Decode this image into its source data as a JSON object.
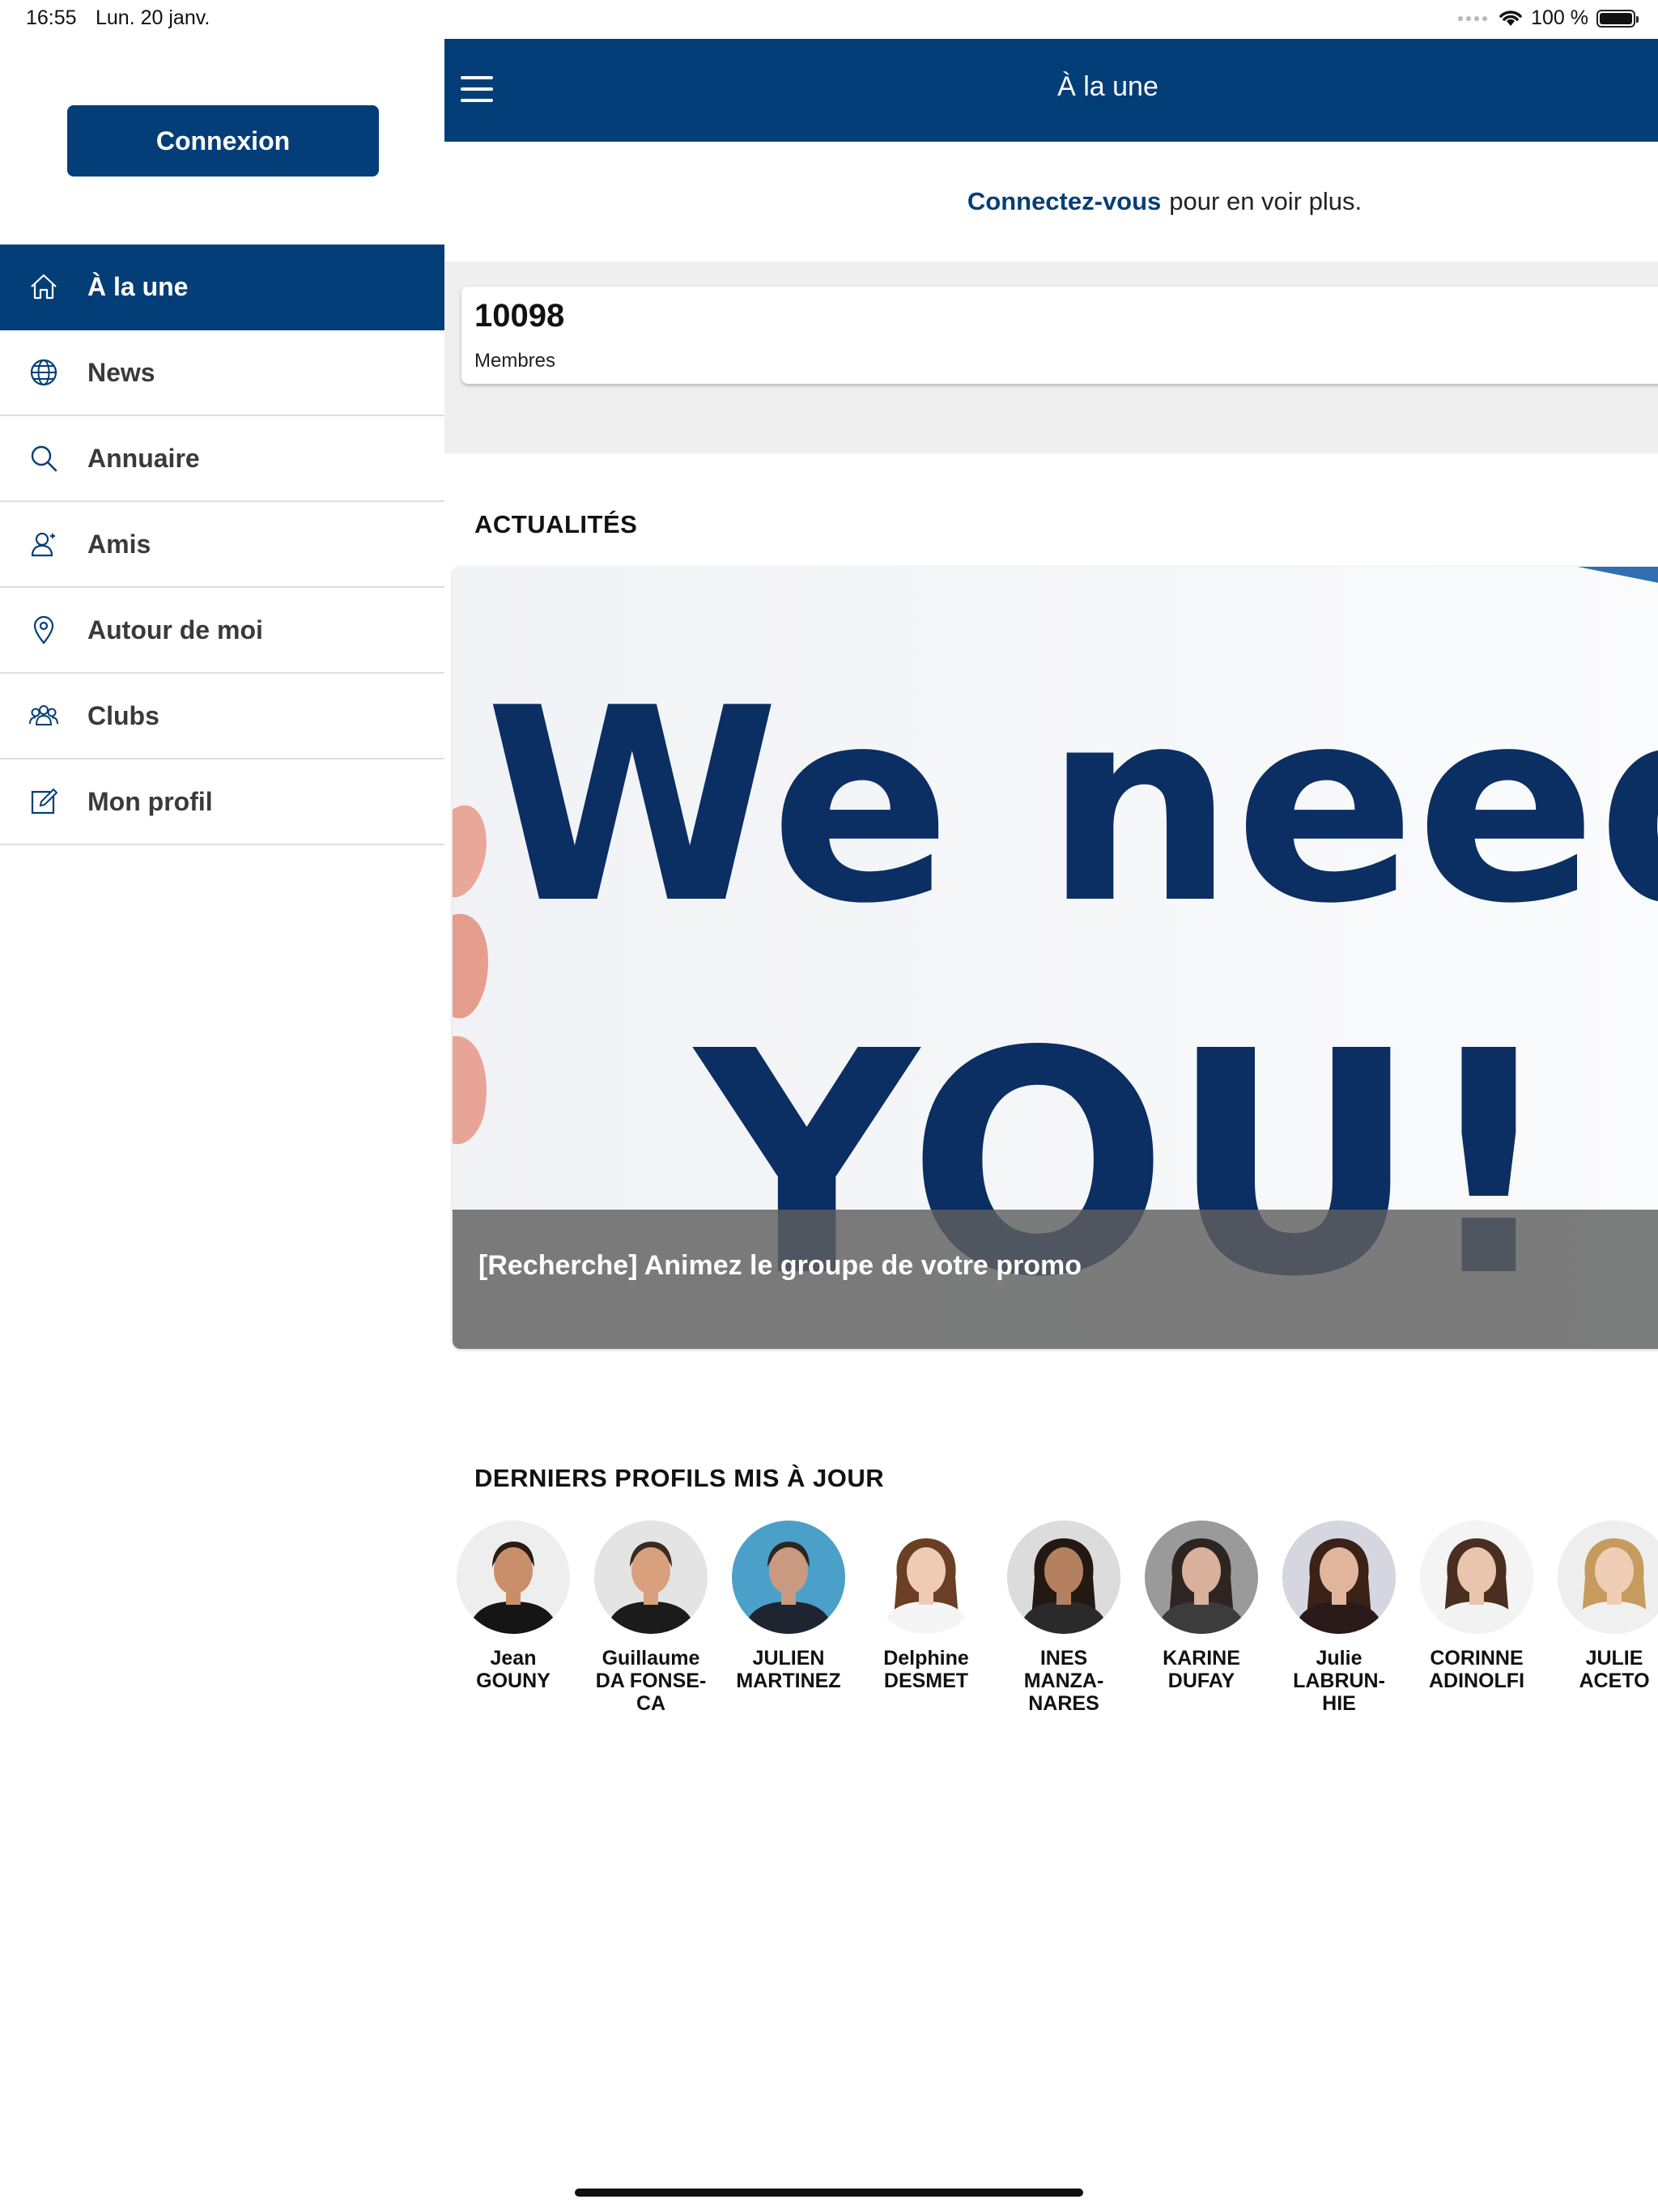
{
  "status_bar": {
    "time": "16:55",
    "date": "Lun. 20 janv.",
    "battery": "100 %"
  },
  "sidebar": {
    "login_label": "Connexion",
    "items": [
      {
        "label": "À la une",
        "icon": "home-icon",
        "active": true
      },
      {
        "label": "News",
        "icon": "globe-icon",
        "active": false
      },
      {
        "label": "Annuaire",
        "icon": "search-icon",
        "active": false
      },
      {
        "label": "Amis",
        "icon": "friend-icon",
        "active": false
      },
      {
        "label": "Autour de moi",
        "icon": "location-pin-icon",
        "active": false
      },
      {
        "label": "Clubs",
        "icon": "group-icon",
        "active": false
      },
      {
        "label": "Mon profil",
        "icon": "edit-icon",
        "active": false
      }
    ]
  },
  "header": {
    "title": "À la une"
  },
  "connect_prompt": {
    "link": "Connectez-vous",
    "text": "pour en voir plus."
  },
  "stats": {
    "count": "10098",
    "label": "Membres"
  },
  "news": {
    "section_title": "ACTUALITÉS",
    "card": {
      "image_text_line1": "We need",
      "image_text_line2": "YOU!",
      "caption": "[Recherche] Animez le groupe de votre promo"
    }
  },
  "profiles": {
    "section_title": "DERNIERS PROFILS MIS À JOUR",
    "items": [
      {
        "name": "Jean\nGOUNY",
        "skin": "#c98f6a",
        "hair": "#2a1c14",
        "shirt": "#151515",
        "bg": "#eeeeee",
        "long_hair": false
      },
      {
        "name": "Guillaume\nDA FONSE-\nCA",
        "skin": "#d9a07e",
        "hair": "#3a2a20",
        "shirt": "#1b1b1b",
        "bg": "#e4e4e4",
        "long_hair": false
      },
      {
        "name": "JULIEN\nMARTINEZ",
        "skin": "#c99a7f",
        "hair": "#2d2520",
        "shirt": "#1e2530",
        "bg": "#4aa0c8",
        "long_hair": false
      },
      {
        "name": "Delphine\nDESMET",
        "skin": "#efcbb6",
        "hair": "#6b3f24",
        "shirt": "#f5f5f5",
        "bg": "#ffffff",
        "long_hair": true
      },
      {
        "name": "INES\nMANZA-\nNARES",
        "skin": "#b4805f",
        "hair": "#241812",
        "shirt": "#2a2a2a",
        "bg": "#dcdcdc",
        "long_hair": true
      },
      {
        "name": "KARINE\nDUFAY",
        "skin": "#d9b19a",
        "hair": "#2e2522",
        "shirt": "#3c3c3c",
        "bg": "#9a9a9a",
        "long_hair": true
      },
      {
        "name": "Julie\nLABRUN-\nHIE",
        "skin": "#e0b59b",
        "hair": "#3a2218",
        "shirt": "#2a1a1a",
        "bg": "#d6d6e0",
        "long_hair": true
      },
      {
        "name": "CORINNE\nADINOLFI",
        "skin": "#e9c5ad",
        "hair": "#4a2e20",
        "shirt": "#f2f2f2",
        "bg": "#f4f4f4",
        "long_hair": true
      },
      {
        "name": "JULIE\nACETO",
        "skin": "#f0cdb5",
        "hair": "#c79a5e",
        "shirt": "#f0f0f0",
        "bg": "#eeeeee",
        "long_hair": true
      }
    ]
  },
  "colors": {
    "brand": "#043e78",
    "active_text": "#ffffff",
    "band": "#efefef"
  }
}
